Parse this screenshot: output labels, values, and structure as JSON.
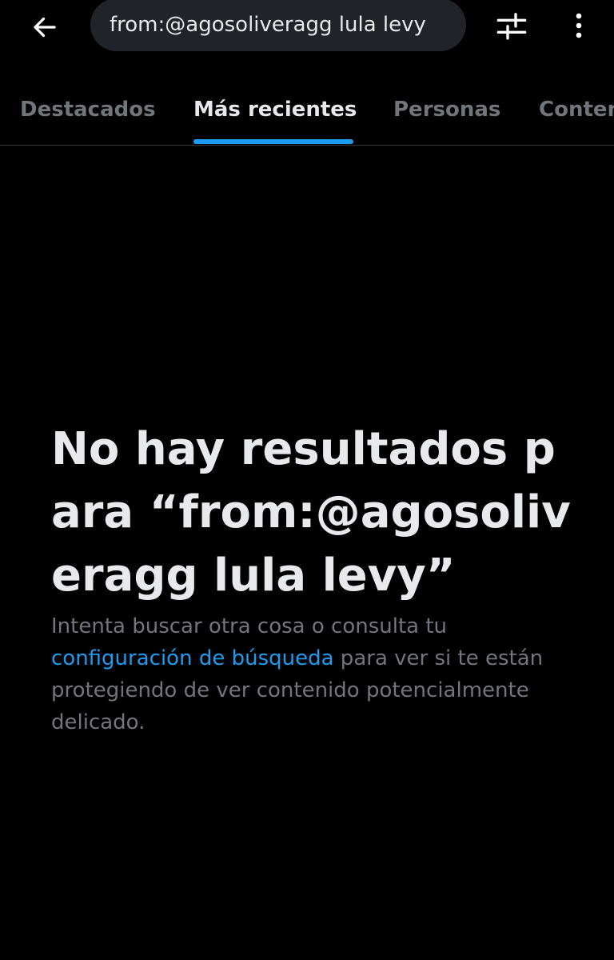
{
  "search": {
    "query": "from:@agosoliveragg lula levy"
  },
  "tabs": [
    {
      "label": "Destacados",
      "active": false
    },
    {
      "label": "Más recientes",
      "active": true
    },
    {
      "label": "Personas",
      "active": false
    },
    {
      "label": "Contenido multimedia",
      "active": false
    }
  ],
  "empty_state": {
    "title": "No hay resultados para “from:@agosoliveragg lula levy”",
    "body_before_link": "Intenta buscar otra cosa o consulta tu ",
    "link_text": "configuración de búsqueda",
    "body_after_link": " para ver si te están protegiendo de ver contenido potencialmente delicado."
  },
  "colors": {
    "background": "#000000",
    "accent": "#1d9bf0",
    "text_primary": "#e7e9ea",
    "text_secondary": "#71767b",
    "search_bg": "#202327"
  },
  "icons": {
    "back": "arrow-left-icon",
    "filter": "sliders-icon",
    "more": "more-vertical-icon"
  }
}
